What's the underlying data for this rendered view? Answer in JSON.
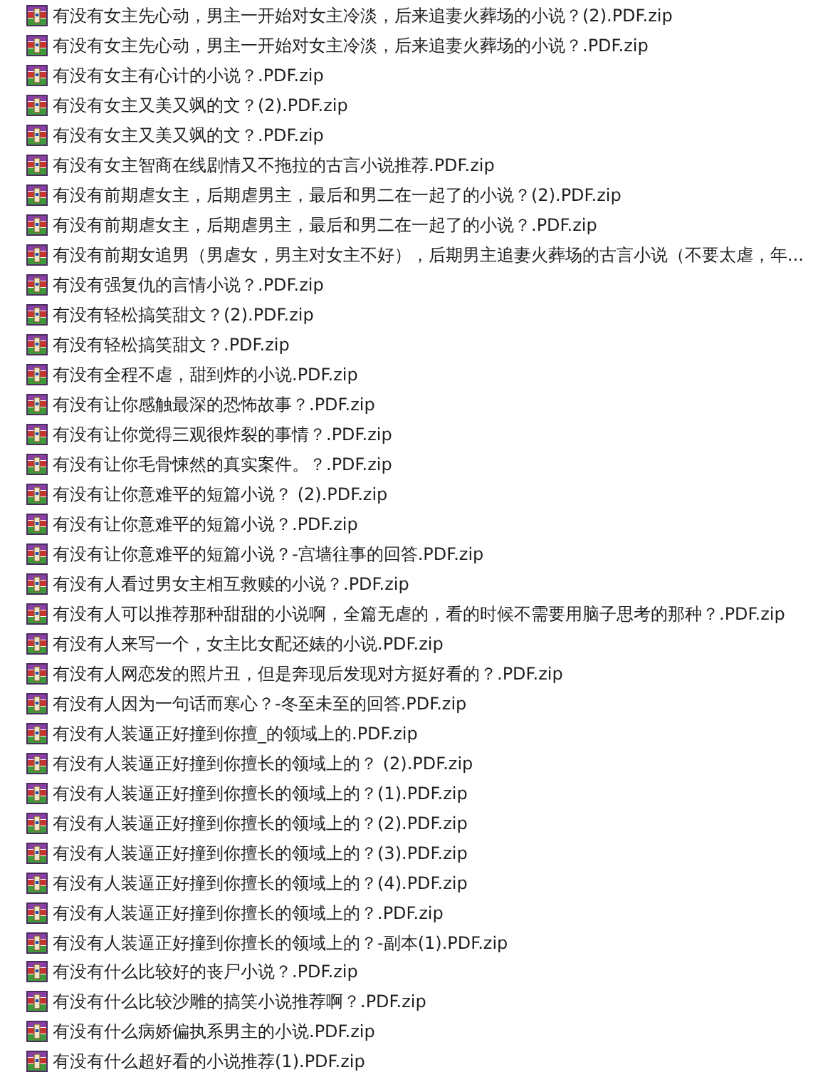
{
  "files": [
    {
      "name": "有没有女主先心动，男主一开始对女主冷淡，后来追妻火葬场的小说？(2).PDF.zip"
    },
    {
      "name": "有没有女主先心动，男主一开始对女主冷淡，后来追妻火葬场的小说？.PDF.zip"
    },
    {
      "name": "有没有女主有心计的小说？.PDF.zip"
    },
    {
      "name": "有没有女主又美又飒的文？(2).PDF.zip"
    },
    {
      "name": "有没有女主又美又飒的文？.PDF.zip"
    },
    {
      "name": "有没有女主智商在线剧情又不拖拉的古言小说推荐.PDF.zip"
    },
    {
      "name": "有没有前期虐女主，后期虐男主，最后和男二在一起了的小说？(2).PDF.zip"
    },
    {
      "name": "有没有前期虐女主，后期虐男主，最后和男二在一起了的小说？.PDF.zip"
    },
    {
      "name": "有没有前期女追男（男虐女，男主对女主不好），后期男主追妻火葬场的古言小说（不要太虐，年..."
    },
    {
      "name": "有没有强复仇的言情小说？.PDF.zip"
    },
    {
      "name": "有没有轻松搞笑甜文？(2).PDF.zip"
    },
    {
      "name": "有没有轻松搞笑甜文？.PDF.zip"
    },
    {
      "name": "有没有全程不虐，甜到炸的小说.PDF.zip"
    },
    {
      "name": "有没有让你感触最深的恐怖故事？.PDF.zip"
    },
    {
      "name": "有没有让你觉得三观很炸裂的事情？.PDF.zip"
    },
    {
      "name": "有没有让你毛骨悚然的真实案件。？.PDF.zip"
    },
    {
      "name": "有没有让你意难平的短篇小说？ (2).PDF.zip"
    },
    {
      "name": "有没有让你意难平的短篇小说？.PDF.zip"
    },
    {
      "name": "有没有让你意难平的短篇小说？-宫墙往事的回答.PDF.zip"
    },
    {
      "name": "有没有人看过男女主相互救赎的小说？.PDF.zip"
    },
    {
      "name": "有没有人可以推荐那种甜甜的小说啊，全篇无虐的，看的时候不需要用脑子思考的那种？.PDF.zip"
    },
    {
      "name": "有没有人来写一个，女主比女配还婊的小说.PDF.zip"
    },
    {
      "name": "有没有人网恋发的照片丑，但是奔现后发现对方挺好看的？.PDF.zip"
    },
    {
      "name": "有没有人因为一句话而寒心？-冬至未至的回答.PDF.zip"
    },
    {
      "name": "有没有人装逼正好撞到你擅_的领域上的.PDF.zip"
    },
    {
      "name": "有没有人装逼正好撞到你擅长的领域上的？ (2).PDF.zip"
    },
    {
      "name": "有没有人装逼正好撞到你擅长的领域上的？(1).PDF.zip"
    },
    {
      "name": "有没有人装逼正好撞到你擅长的领域上的？(2).PDF.zip"
    },
    {
      "name": "有没有人装逼正好撞到你擅长的领域上的？(3).PDF.zip"
    },
    {
      "name": "有没有人装逼正好撞到你擅长的领域上的？(4).PDF.zip"
    },
    {
      "name": "有没有人装逼正好撞到你擅长的领域上的？.PDF.zip"
    },
    {
      "name": "有没有人装逼正好撞到你擅长的领域上的？-副本(1).PDF.zip"
    },
    {
      "name": "有没有什么比较好的丧尸小说？.PDF.zip"
    },
    {
      "name": "有没有什么比较沙雕的搞笑小说推荐啊？.PDF.zip"
    },
    {
      "name": "有没有什么病娇偏执系男主的小说.PDF.zip"
    },
    {
      "name": "有没有什么超好看的小说推荐(1).PDF.zip"
    }
  ]
}
